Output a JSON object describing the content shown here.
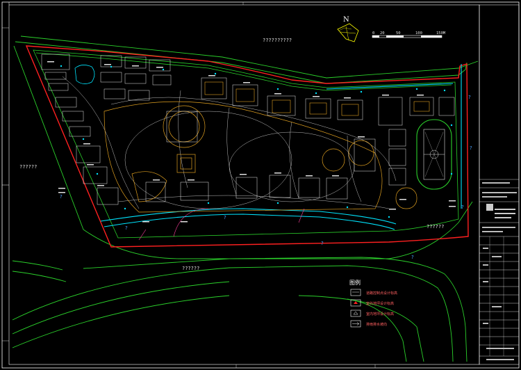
{
  "north_label": "N",
  "scale_bar": {
    "ticks": [
      "0",
      "20",
      "50",
      "100",
      "150M"
    ]
  },
  "area_labels": {
    "north": "??????????",
    "west": "??????",
    "southeast": "??????",
    "south": "??????"
  },
  "legend": {
    "title": "图例",
    "items": [
      "道路控制点设计标高",
      "室外地坪设计标高",
      "室内地坪设计标高",
      "排雨排水坡向"
    ]
  },
  "colors": {
    "background": "#000000",
    "boundary": "#ff2020",
    "green_line": "#2bd12b",
    "river": "#00e5ff",
    "buildings": "#e0a020",
    "frame": "#ffffff"
  }
}
